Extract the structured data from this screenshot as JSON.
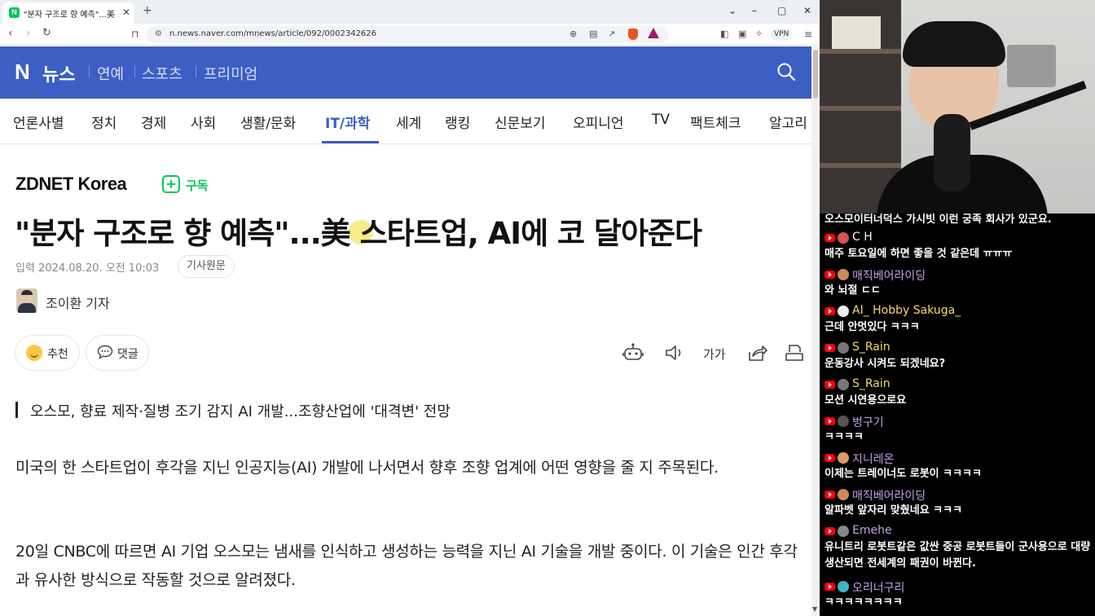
{
  "browser": {
    "tab_title": "\"분자 구조로 향 예측\"...美 스타트",
    "tab_favicon": "N",
    "tab_close": "✕",
    "new_tab": "+",
    "url": "n.news.naver.com/mnews/article/092/0002342626",
    "vpn_label": "VPN",
    "icons": [
      "back-icon",
      "forward-icon",
      "reload-icon",
      "bookmark-icon",
      "site-info-icon",
      "zoom-icon",
      "reader-icon",
      "share-icon",
      "brave-shield-icon",
      "rewards-icon",
      "sidebar-icon",
      "wallet-icon",
      "leo-icon",
      "menu-icon"
    ],
    "window_controls": [
      "⌄",
      "–",
      "▢",
      "✕"
    ]
  },
  "naver": {
    "logo_n": "N",
    "logo_news": "뉴스",
    "header_links": [
      "연예",
      "스포츠",
      "프리미엄"
    ],
    "categories": [
      "언론사별",
      "정치",
      "경제",
      "사회",
      "생활/문화",
      "IT/과학",
      "세계",
      "랭킹",
      "신문보기",
      "오피니언",
      "TV",
      "팩트체크",
      "알고리"
    ],
    "active_category": "IT/과학",
    "brand_color": "#3c5ec5"
  },
  "article": {
    "press": "ZDNET Korea",
    "subscribe_label": "구독",
    "headline": "\"분자 구조로 향 예측\"...美 스타트업, AI에 코 달아준다",
    "date": "입력 2024.08.20. 오전 10:03",
    "original_label": "기사원문",
    "reporter": "조이환 기자",
    "like_label": "추천",
    "comment_label": "댓글",
    "font_size_label": "가가",
    "summary": "오스모, 향료 제작·질병 조기 감지 AI 개발...조향산업에 '대격변' 전망",
    "paragraphs": [
      "미국의 한 스타트업이 후각을 지닌 인공지능(AI) 개발에 나서면서 향후 조향 업계에 어떤 영향을 줄 지 주목된다.",
      "20일 CNBC에 따르면 AI 기업 오스모는 냄새를 인식하고 생성하는 능력을 지닌 AI 기술을 개발 중이다. 이 기술은 인간 후각과 유사한 방식으로 작동할 것으로 알려졌다."
    ]
  },
  "chat": {
    "cut_top": "오스모이터너덕스 가시빗 이런 궁족 회사가 있군요.",
    "messages": [
      {
        "user": "C H",
        "text": "매주 토요일에 하면 좋을 것 같은데 ㅠㅠㅠ",
        "user_color": "#f2f2f2",
        "avatar_color": "#d9534f"
      },
      {
        "user": "매직베어라이딩",
        "text": "와 뇌절 ㄷㄷ",
        "user_color": "#c0a0e8",
        "avatar_color": "#c98a5e"
      },
      {
        "user": "AI_ Hobby Sakuga_",
        "text": "근데 안멋있다 ㅋㅋㅋ",
        "user_color": "#f3d96b",
        "avatar_color": "#eeeeee"
      },
      {
        "user": "S_Rain",
        "text": "운동강사 시켜도 되겠네요?",
        "user_color": "#f3d96b",
        "avatar_color": "#777777"
      },
      {
        "user": "S_Rain",
        "text": "모션 시연용으로요",
        "user_color": "#f3d96b",
        "avatar_color": "#777777"
      },
      {
        "user": "벙구기",
        "text": "ㅋㅋㅋㅋ",
        "user_color": "#c0a0e8",
        "avatar_color": "#555555"
      },
      {
        "user": "지니레온",
        "text": "이제는 트레이너도 로봇이 ㅋㅋㅋㅋ",
        "user_color": "#c0a0e8",
        "avatar_color": "#d99a6c"
      },
      {
        "user": "매직베어라이딩",
        "text": "알파벳 앞자리 맞췄네요 ㅋㅋㅋ",
        "user_color": "#c0a0e8",
        "avatar_color": "#c98a5e"
      },
      {
        "user": "Emehe",
        "text": "유니트리 로봇트같은 값싼 중공 로봇트들이 군사용으로 대량 생산되면 전세계의 패권이 바뀐다.",
        "user_color": "#c0a0e8",
        "avatar_color": "#888888"
      },
      {
        "user": "오리너구리",
        "text": "ㅋㅋㅋㅋㅋㅋㅋㅋ",
        "user_color": "#c0a0e8",
        "avatar_color": "#3fb6c8"
      }
    ]
  }
}
